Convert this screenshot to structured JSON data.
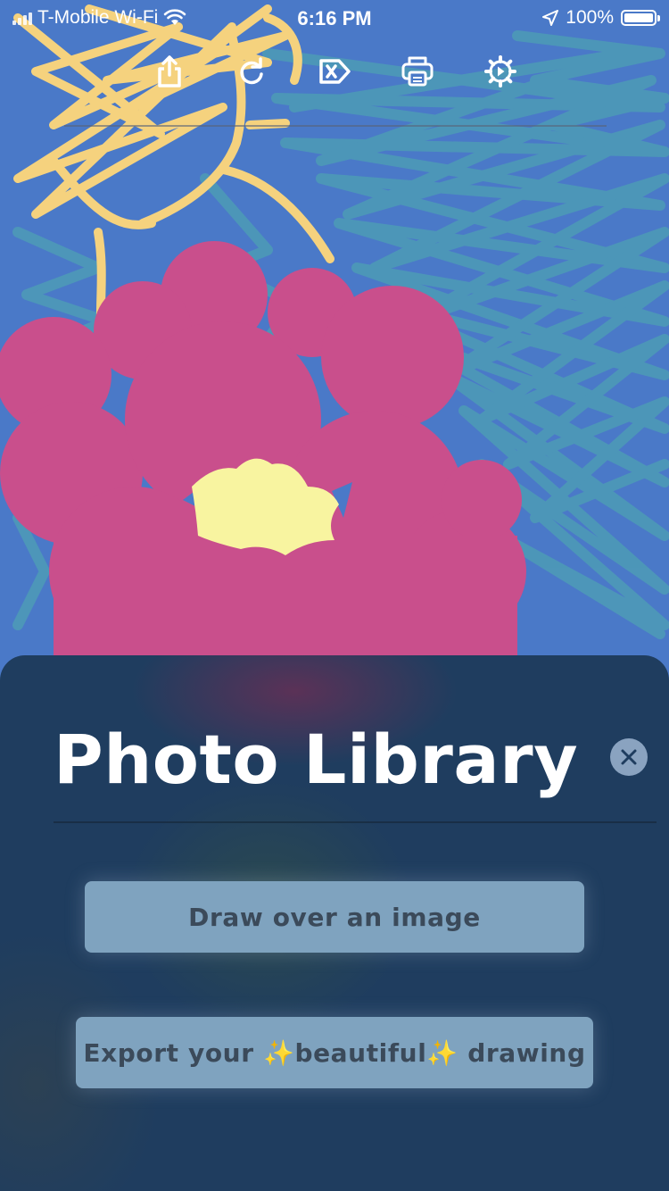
{
  "status_bar": {
    "carrier": "T-Mobile Wi-Fi",
    "time": "6:16 PM",
    "battery": "100%",
    "icons": [
      "signal-icon",
      "wifi-icon",
      "location-arrow-icon",
      "battery-icon"
    ]
  },
  "toolbar": {
    "buttons": [
      "share-icon",
      "redo-icon",
      "clear-icon",
      "print-icon",
      "settings-icon"
    ]
  },
  "sheet": {
    "title": "Photo Library",
    "close_icon": "close-icon",
    "draw_over_label": "Draw over an image",
    "export_label": "Export your ✨beautiful✨ drawing"
  },
  "colors": {
    "canvas_background": "#4a79c8",
    "scribble_teal": "#4d98b8",
    "scribble_yellow": "#f5d27e",
    "flower_pink": "#c94f8c",
    "flower_center": "#f8f4a0",
    "sheet_background": "#1f3d5f",
    "button_background": "#7fa3bf",
    "button_text": "#3b4a5a"
  }
}
